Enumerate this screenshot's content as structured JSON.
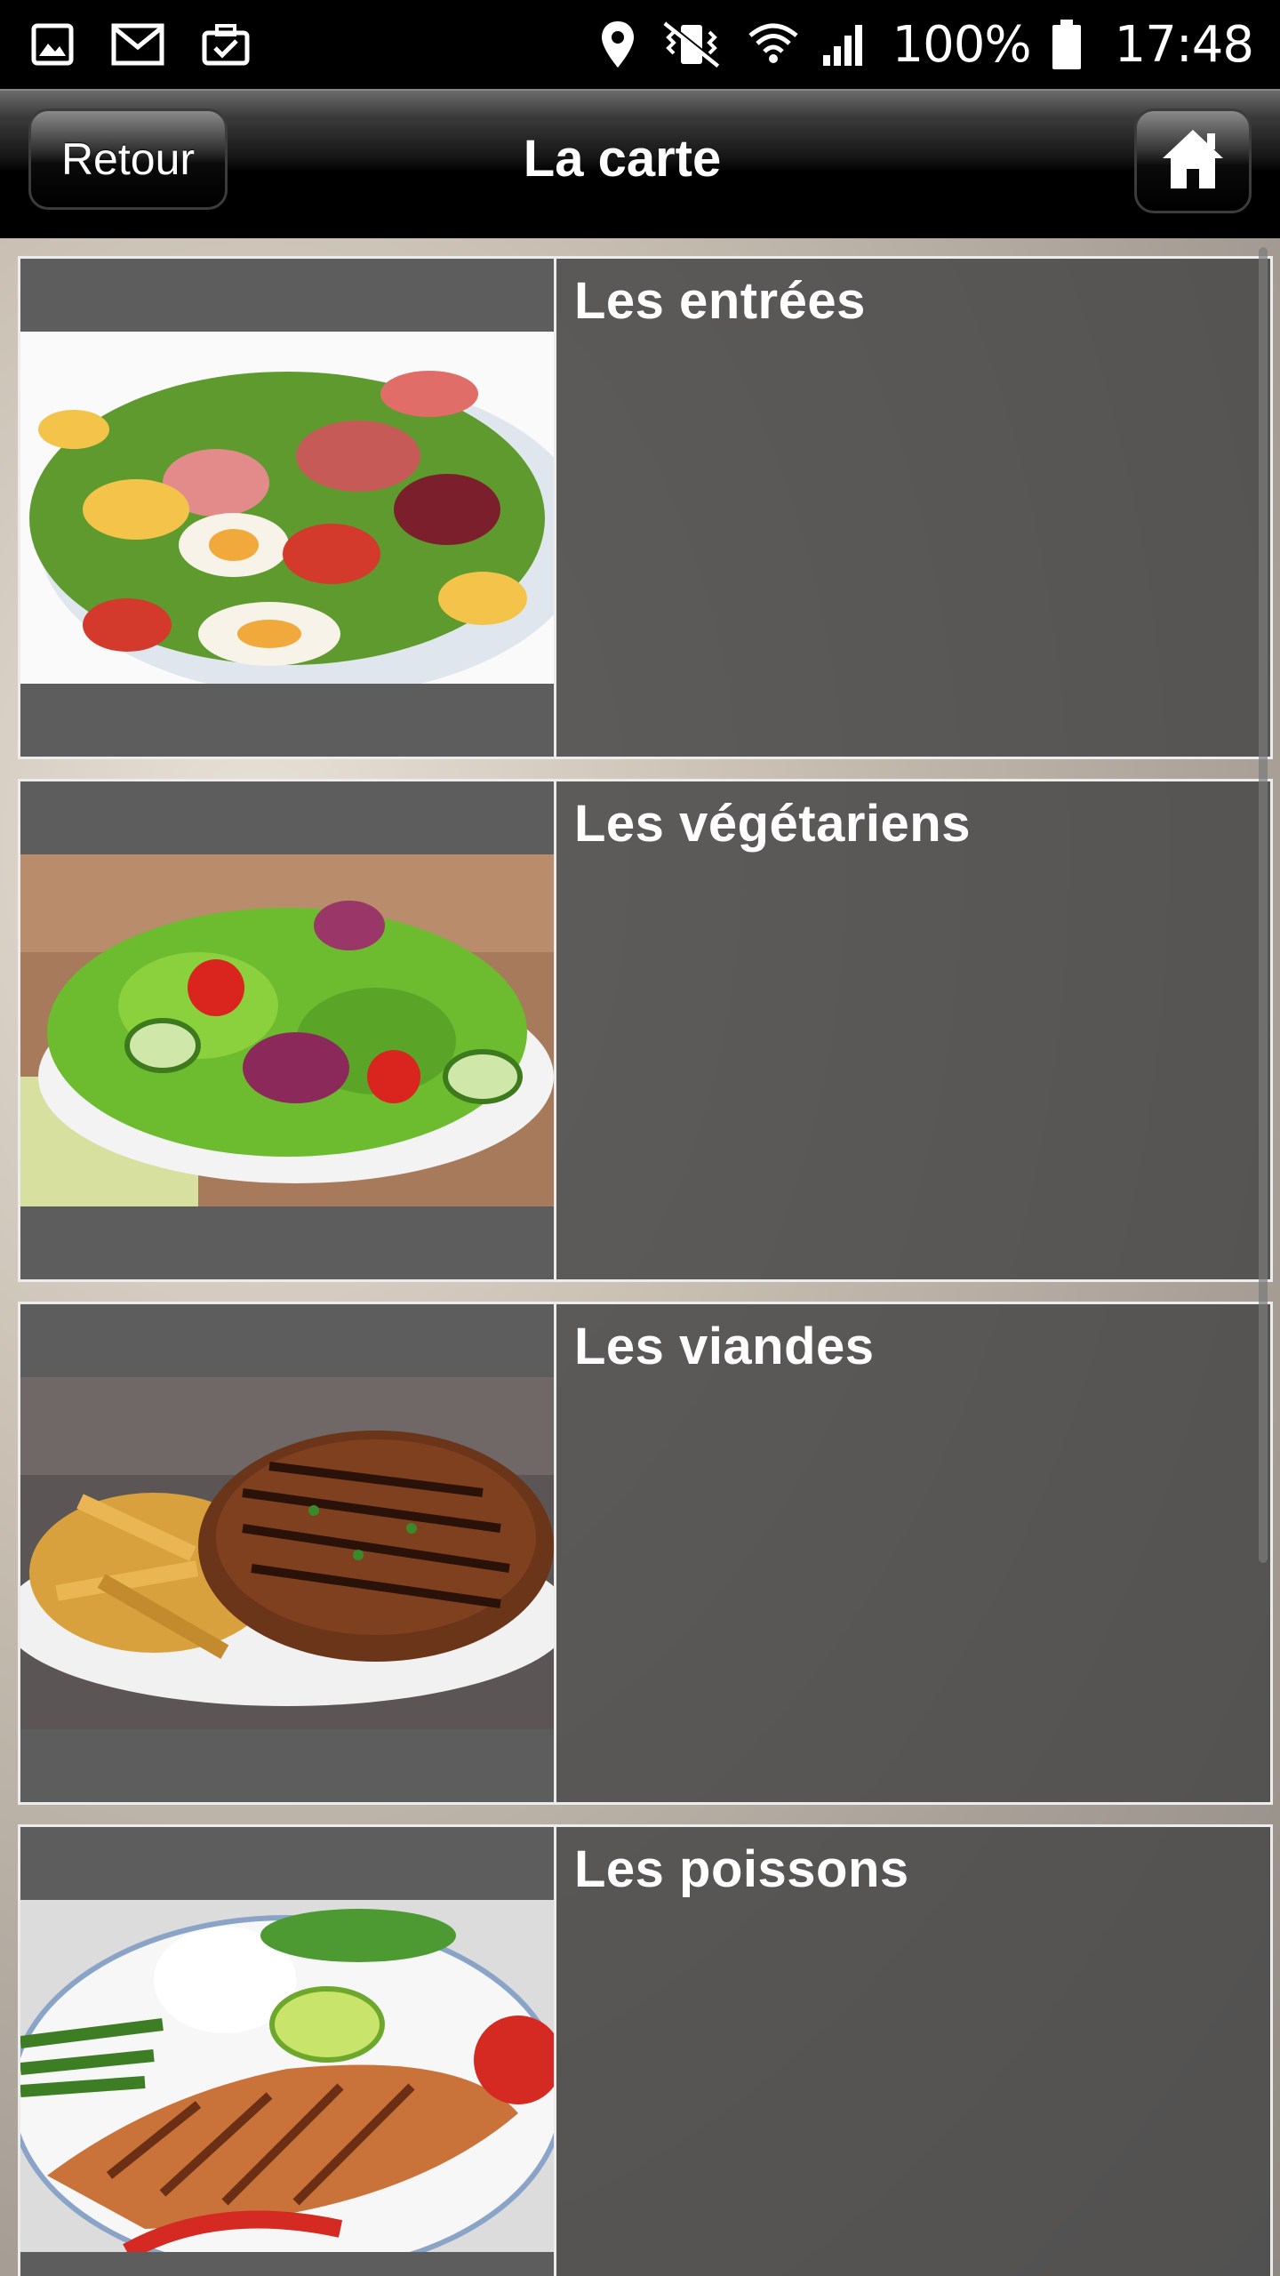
{
  "status_bar": {
    "battery_percent": "100%",
    "time": "17:48",
    "left_icons": [
      "gallery-icon",
      "gmail-icon",
      "briefcase-check-icon"
    ],
    "right_icons": [
      "location-icon",
      "vibrate-icon",
      "wifi-icon",
      "signal-icon",
      "battery-icon"
    ]
  },
  "header": {
    "title": "La carte",
    "back_label": "Retour",
    "home_icon": "home-icon"
  },
  "menu": {
    "items": [
      {
        "label": "Les entrées",
        "image": "salad-with-eggs-and-ham"
      },
      {
        "label": "Les végétariens",
        "image": "green-salad-with-tomatoes"
      },
      {
        "label": "Les viandes",
        "image": "grilled-steak-with-fries"
      },
      {
        "label": "Les poissons",
        "image": "grilled-salmon-with-rice"
      }
    ]
  },
  "colors": {
    "header_bg": "#000000",
    "item_overlay": "#484848",
    "item_border": "#ececec",
    "text": "#ffffff"
  }
}
